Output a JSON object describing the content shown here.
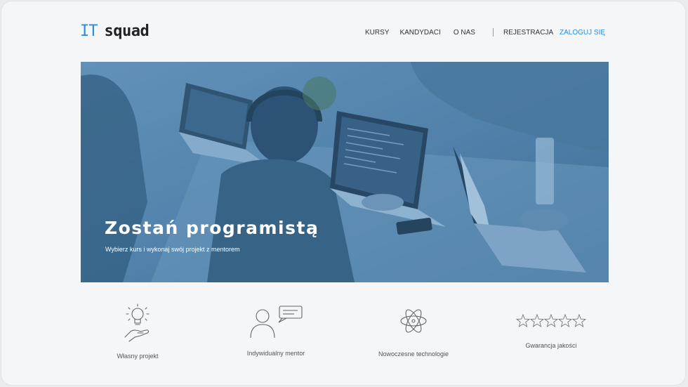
{
  "header": {
    "logo_it": "IT",
    "logo_name": "squad",
    "nav": [
      "KURSY",
      "KANDYDACI",
      "O NAS"
    ],
    "register": "REJESTRACJA",
    "login": "ZALOGUJ SIĘ"
  },
  "hero": {
    "title": "Zostań programistą",
    "subtitle": "Wybierz kurs i wykonaj swój projekt z mentorem"
  },
  "features": [
    {
      "label": "Własny projekt",
      "icon": "lightbulb-hand-icon"
    },
    {
      "label": "Indywidualny mentor",
      "icon": "person-speech-icon"
    },
    {
      "label": "Nowoczesne technologie",
      "icon": "atom-icon"
    },
    {
      "label": "Gwarancja jakości",
      "icon": "stars-icon"
    }
  ],
  "colors": {
    "accent": "#2a8ddf",
    "hero_overlay": "#4f7fa6",
    "background": "#f5f6f8"
  }
}
